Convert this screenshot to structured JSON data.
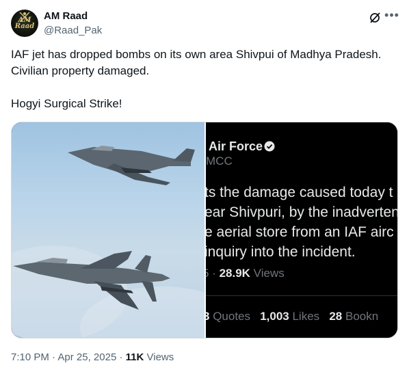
{
  "author": {
    "name": "AM Raad",
    "handle": "@Raad_Pak",
    "avatar_text_top": "AM",
    "avatar_text_bottom": "Raad"
  },
  "tweet": {
    "text": "IAF jet has dropped bombs on its own area Shivpui of Madhya Pradesh.\nCivilian property damaged.\n\nHogyi Surgical Strike!"
  },
  "media": {
    "left_image_icon": "fighter-jets-photo",
    "screenshot": {
      "account_name": "Air Force",
      "account_handle": "MCC",
      "body_lines": [
        "ts the damage caused today t",
        "ear Shivpuri, by the inadverten",
        "e aerial store from an IAF airc",
        "inquiry into the incident."
      ],
      "views_prefix": "5 · ",
      "views_count": "28.9K",
      "views_label": "Views",
      "quotes_prefix": "3",
      "quotes_label": "Quotes",
      "likes_count": "1,003",
      "likes_label": "Likes",
      "bookmarks_count": "28",
      "bookmarks_label": "Bookn"
    }
  },
  "footer": {
    "time": "7:10 PM",
    "separator1": " · ",
    "date": "Apr 25, 2025",
    "separator2": " · ",
    "views_count": "11K",
    "views_label": "Views"
  },
  "colors": {
    "text": "#0f1419",
    "secondary": "#536471",
    "verified": "#e7e9ea"
  }
}
